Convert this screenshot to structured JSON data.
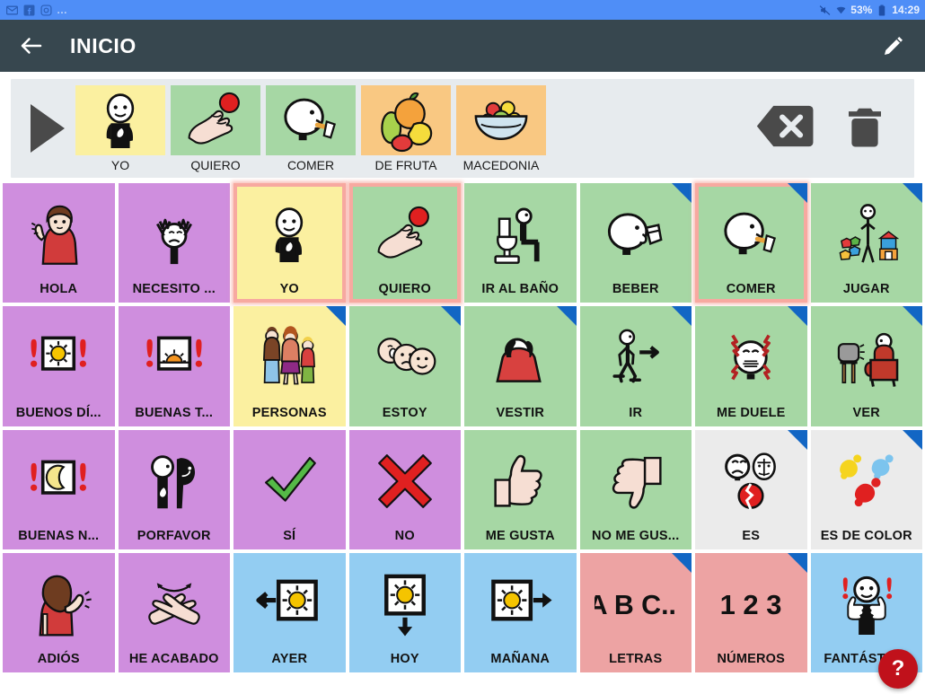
{
  "statusbar": {
    "left_icons": [
      "gmail-icon",
      "facebook-icon",
      "instagram-icon"
    ],
    "overflow": "…",
    "right_icons": [
      "mute-icon",
      "wifi-icon"
    ],
    "battery": "53%",
    "time": "14:29",
    "bg_color": "#4f8ef7"
  },
  "appbar": {
    "back_icon": "back-arrow-icon",
    "title": "INICIO",
    "edit_icon": "pencil-icon",
    "bg_color": "#37474f"
  },
  "sentence_strip": {
    "play_icon": "play-icon",
    "backspace_icon": "backspace-icon",
    "trash_icon": "trash-icon",
    "bg_color": "#e7ebee",
    "items": [
      {
        "label": "YO",
        "color": "#fbf0a0",
        "pic": "person-self"
      },
      {
        "label": "QUIERO",
        "color": "#a6d7a4",
        "pic": "hand-ball"
      },
      {
        "label": "COMER",
        "color": "#a6d7a4",
        "pic": "eat-spoon"
      },
      {
        "label": "DE FRUTA",
        "color": "#f9c882",
        "pic": "fruits"
      },
      {
        "label": "MACEDONIA",
        "color": "#f9c882",
        "pic": "fruit-bowl"
      }
    ]
  },
  "colors": {
    "purple": "#cf8ede",
    "green": "#a6d7a4",
    "yellow": "#fbf0a0",
    "blue": "#93cdf2",
    "pink": "#eda3a3",
    "grey": "#ebebeb",
    "corner_blue": "#1266c4",
    "selection": "#f7a9a0"
  },
  "grid": {
    "columns": 8,
    "rows": 4,
    "cells": [
      {
        "label": "HOLA",
        "color": "#cf8ede",
        "category": false,
        "selected": false,
        "pic": "girl-waving"
      },
      {
        "label": "NECESITO ...",
        "color": "#cf8ede",
        "category": false,
        "selected": false,
        "pic": "person-need"
      },
      {
        "label": "YO",
        "color": "#fbf0a0",
        "category": false,
        "selected": true,
        "pic": "person-self"
      },
      {
        "label": "QUIERO",
        "color": "#a6d7a4",
        "category": false,
        "selected": true,
        "pic": "hand-ball"
      },
      {
        "label": "IR AL BAÑO",
        "color": "#a6d7a4",
        "category": false,
        "selected": false,
        "pic": "toilet"
      },
      {
        "label": "BEBER",
        "color": "#a6d7a4",
        "category": true,
        "selected": false,
        "pic": "drink-cup"
      },
      {
        "label": "COMER",
        "color": "#a6d7a4",
        "category": true,
        "selected": true,
        "pic": "eat-spoon"
      },
      {
        "label": "JUGAR",
        "color": "#a6d7a4",
        "category": true,
        "selected": false,
        "pic": "play-toys"
      },
      {
        "label": "BUENOS DÍ...",
        "color": "#cf8ede",
        "category": false,
        "selected": false,
        "pic": "sun-box"
      },
      {
        "label": "BUENAS T...",
        "color": "#cf8ede",
        "category": false,
        "selected": false,
        "pic": "sunset-box"
      },
      {
        "label": "PERSONAS",
        "color": "#fbf0a0",
        "category": true,
        "selected": false,
        "pic": "family"
      },
      {
        "label": "ESTOY",
        "color": "#a6d7a4",
        "category": true,
        "selected": false,
        "pic": "faces-three"
      },
      {
        "label": "VESTIR",
        "color": "#a6d7a4",
        "category": true,
        "selected": false,
        "pic": "dressing"
      },
      {
        "label": "IR",
        "color": "#a6d7a4",
        "category": true,
        "selected": false,
        "pic": "walking-arrow"
      },
      {
        "label": "ME DUELE",
        "color": "#a6d7a4",
        "category": true,
        "selected": false,
        "pic": "pain-face"
      },
      {
        "label": "VER",
        "color": "#a6d7a4",
        "category": true,
        "selected": false,
        "pic": "tv-watching"
      },
      {
        "label": "BUENAS N...",
        "color": "#cf8ede",
        "category": false,
        "selected": false,
        "pic": "moon-box"
      },
      {
        "label": "PORFAVOR",
        "color": "#cf8ede",
        "category": false,
        "selected": false,
        "pic": "please-two"
      },
      {
        "label": "SÍ",
        "color": "#cf8ede",
        "category": false,
        "selected": false,
        "pic": "check"
      },
      {
        "label": "NO",
        "color": "#cf8ede",
        "category": false,
        "selected": false,
        "pic": "cross"
      },
      {
        "label": "ME GUSTA",
        "color": "#a6d7a4",
        "category": false,
        "selected": false,
        "pic": "thumb-up"
      },
      {
        "label": "NO ME GUS...",
        "color": "#a6d7a4",
        "category": false,
        "selected": false,
        "pic": "thumb-down"
      },
      {
        "label": "ES",
        "color": "#ebebeb",
        "category": true,
        "selected": false,
        "pic": "es-faces"
      },
      {
        "label": "ES DE COLOR",
        "color": "#ebebeb",
        "category": true,
        "selected": false,
        "pic": "paint-splats"
      },
      {
        "label": "ADIÓS",
        "color": "#cf8ede",
        "category": false,
        "selected": false,
        "pic": "girl-bye"
      },
      {
        "label": "HE ACABADO",
        "color": "#cf8ede",
        "category": false,
        "selected": false,
        "pic": "hands-crossed"
      },
      {
        "label": "AYER",
        "color": "#93cdf2",
        "category": false,
        "selected": false,
        "pic": "sun-left"
      },
      {
        "label": "HOY",
        "color": "#93cdf2",
        "category": false,
        "selected": false,
        "pic": "sun-down"
      },
      {
        "label": "MAÑANA",
        "color": "#93cdf2",
        "category": false,
        "selected": false,
        "pic": "sun-right"
      },
      {
        "label": "LETRAS",
        "color": "#eda3a3",
        "category": true,
        "selected": false,
        "pic": "abc"
      },
      {
        "label": "NÚMEROS",
        "color": "#eda3a3",
        "category": true,
        "selected": false,
        "pic": "123"
      },
      {
        "label": "FANTÁSTICO",
        "color": "#93cdf2",
        "category": false,
        "selected": false,
        "pic": "thumbs-both"
      }
    ]
  },
  "help_fab": {
    "label": "?",
    "color": "#c0111b"
  }
}
